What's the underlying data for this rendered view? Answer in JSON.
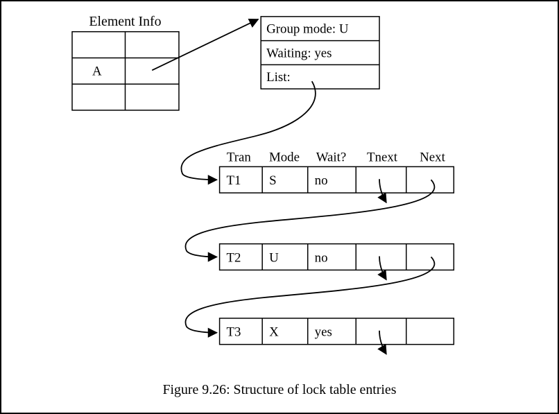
{
  "title": "Element Info",
  "grid": {
    "cell_label": "A"
  },
  "groupbox": {
    "line1": "Group mode: U",
    "line2": "Waiting: yes",
    "line3": "List:"
  },
  "headers": {
    "tran": "Tran",
    "mode": "Mode",
    "wait": "Wait?",
    "tnext": "Tnext",
    "next": "Next"
  },
  "rows": [
    {
      "tran": "T1",
      "mode": "S",
      "wait": "no"
    },
    {
      "tran": "T2",
      "mode": "U",
      "wait": "no"
    },
    {
      "tran": "T3",
      "mode": "X",
      "wait": "yes"
    }
  ],
  "caption": "Figure 9.26:  Structure of lock table entries"
}
